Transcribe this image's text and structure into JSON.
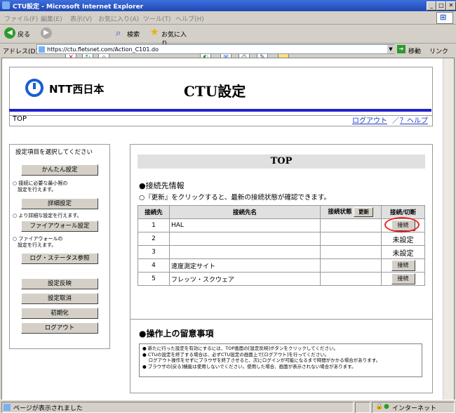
{
  "window": {
    "title": "CTU設定 - Microsoft Internet Explorer"
  },
  "menu": [
    "ファイル(F)",
    "編集(E)",
    "表示(V)",
    "お気に入り(A)",
    "ツール(T)",
    "ヘルプ(H)"
  ],
  "toolbar": {
    "back": "戻る",
    "search": "検索",
    "favorites": "お気に入り"
  },
  "address": {
    "label": "アドレス(D)",
    "url": "https://ctu.fletsnet.com/Action_C101.do",
    "go": "移動",
    "links": "リンク"
  },
  "header": {
    "brand": "NTT西日本",
    "title": "CTU設定"
  },
  "nav": {
    "page": "TOP",
    "logout": "ログアウト",
    "sep": "／",
    "help": "？ヘルプ"
  },
  "sidebar": {
    "prompt": "設定項目を選択してください",
    "buttons": [
      "かんたん設定",
      "詳細設定",
      "ファイアウォール設定",
      "ログ・ステータス参照",
      "設定反映",
      "設定取消",
      "初期化",
      "ログアウト"
    ],
    "notes": [
      [
        "○ 接続に必要な最小限の",
        "　設定を行えます。"
      ],
      [
        "○ より詳細な設定を行えます。"
      ],
      [
        "○ ファイアウォールの",
        "　設定を行えます。"
      ]
    ]
  },
  "main": {
    "title": "TOP",
    "section1": "●接続先情報",
    "section1_note": "○『更新』をクリックすると、最新の接続状態が確認できます。",
    "headers": {
      "no": "接続先",
      "name": "接続先名",
      "status": "接続状態",
      "refresh": "更新",
      "action": "接続/切断"
    },
    "rows": [
      {
        "no": "1",
        "name": "HAL",
        "action": "接続"
      },
      {
        "no": "2",
        "name": "",
        "action": "未設定"
      },
      {
        "no": "3",
        "name": "",
        "action": "未設定"
      },
      {
        "no": "4",
        "name": "速度測定サイト",
        "action": "接続"
      },
      {
        "no": "5",
        "name": "フレッツ・スクウェア",
        "action": "接続"
      }
    ],
    "section2": "●操作上の留意事項",
    "notes": [
      "● 新たに行った設定を有効にするには、TOP画面の[設定反映]ボタンをクリックしてください。",
      "● CTUの設定を終了する場合は、必ずCTU設定の画面上で[ログアウト]を行ってください。",
      "　 ログアウト操作をせずにブラウザを終了させると、次にログインが可能になるまで時間がかかる場合があります。",
      "● ブラウザの[戻る]機能は使用しないでください。使用した場合、画面が表示されない場合があります。"
    ]
  },
  "status": {
    "text": "ページが表示されました",
    "zone": "インターネット"
  },
  "colors": {
    "accent_bar": "#2222cc",
    "highlight": "#ee2222",
    "title_bar": "#2a55c8"
  }
}
